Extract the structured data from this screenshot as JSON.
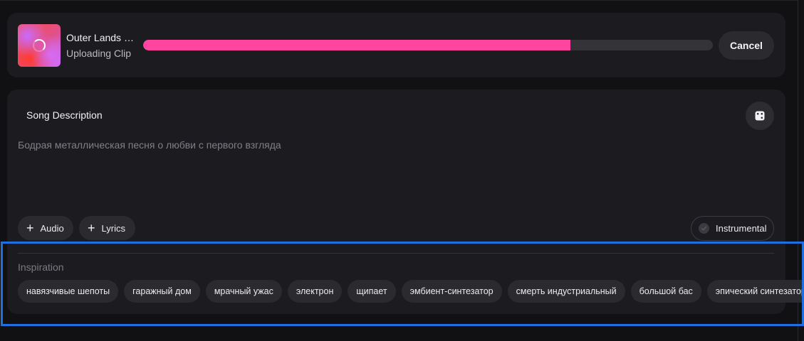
{
  "upload": {
    "title": "Outer Lands 1...",
    "status": "Uploading Clip",
    "progress_percent": 75,
    "cancel_label": "Cancel"
  },
  "description": {
    "heading": "Song Description",
    "placeholder": "Бодрая металлическая песня о любви с первого взгляда",
    "audio_label": "Audio",
    "lyrics_label": "Lyrics",
    "instrumental_label": "Instrumental"
  },
  "inspiration": {
    "label": "Inspiration",
    "tags": [
      "навязчивые шепоты",
      "гаражный дом",
      "мрачный ужас",
      "электрон",
      "щипает",
      "эмбиент-синтезатор",
      "смерть индустриальный",
      "большой бас",
      "эпический синтезатор"
    ]
  },
  "colors": {
    "accent": "#ff45a0",
    "card_bg": "#1c1c20",
    "page_bg": "#111114",
    "highlight": "#1e6fe0"
  },
  "icons": {
    "spinner": "loading-spinner-icon",
    "dice": "dice-icon",
    "plus": "plus-icon",
    "check": "check-circle-icon"
  }
}
